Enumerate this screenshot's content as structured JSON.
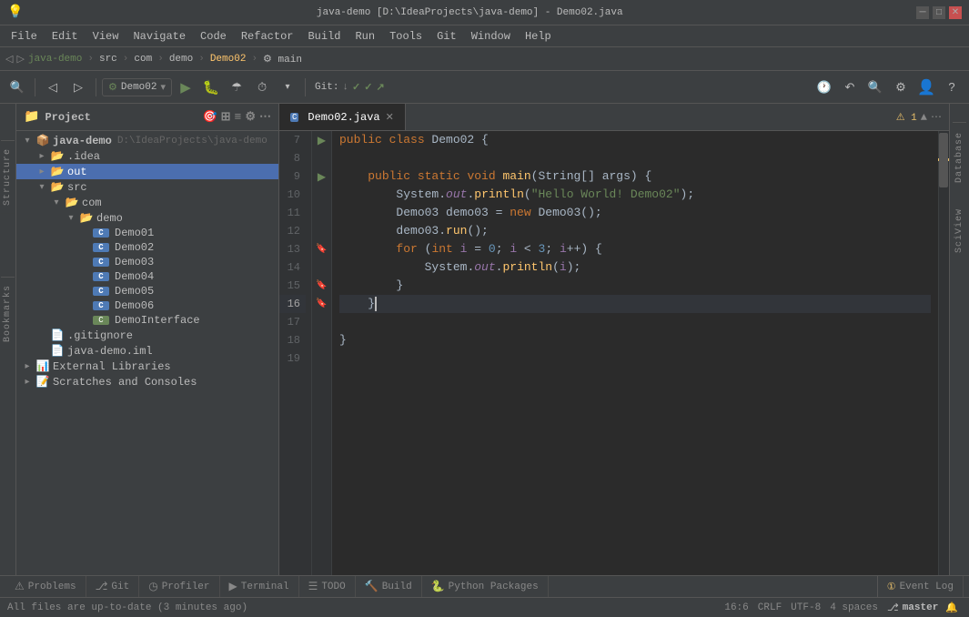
{
  "titleBar": {
    "title": "java-demo [D:\\IdeaProjects\\java-demo] - Demo02.java",
    "appName": "java-demo",
    "minBtn": "─",
    "maxBtn": "□",
    "closeBtn": "✕"
  },
  "menuBar": {
    "items": [
      "File",
      "Edit",
      "View",
      "Navigate",
      "Code",
      "Refactor",
      "Build",
      "Run",
      "Tools",
      "Git",
      "Window",
      "Help"
    ]
  },
  "navBar": {
    "project": "java-demo",
    "parts": [
      "java-demo",
      "src",
      "com",
      "demo",
      "Demo02",
      "main"
    ]
  },
  "toolbar": {
    "runConfig": "Demo02",
    "gitLabel": "Git:",
    "gitBtns": [
      "✓",
      "✓",
      "↗"
    ]
  },
  "projectPanel": {
    "title": "Project",
    "rootName": "java-demo",
    "rootPath": "D:\\IdeaProjects\\java-demo",
    "tree": [
      {
        "indent": 0,
        "type": "root",
        "name": "java-demo",
        "path": "D:\\IdeaProjects\\java-demo",
        "expanded": true
      },
      {
        "indent": 1,
        "type": "folder",
        "name": ".idea",
        "expanded": false
      },
      {
        "indent": 1,
        "type": "folder-out",
        "name": "out",
        "expanded": false,
        "selected": true
      },
      {
        "indent": 1,
        "type": "folder-src",
        "name": "src",
        "expanded": true
      },
      {
        "indent": 2,
        "type": "folder",
        "name": "com",
        "expanded": true
      },
      {
        "indent": 3,
        "type": "folder",
        "name": "demo",
        "expanded": true
      },
      {
        "indent": 4,
        "type": "java",
        "name": "Demo01"
      },
      {
        "indent": 4,
        "type": "java",
        "name": "Demo02"
      },
      {
        "indent": 4,
        "type": "java",
        "name": "Demo03"
      },
      {
        "indent": 4,
        "type": "java",
        "name": "Demo04"
      },
      {
        "indent": 4,
        "type": "java",
        "name": "Demo05"
      },
      {
        "indent": 4,
        "type": "java",
        "name": "Demo06"
      },
      {
        "indent": 4,
        "type": "java-green",
        "name": "DemoInterface"
      },
      {
        "indent": 1,
        "type": "file",
        "name": ".gitignore"
      },
      {
        "indent": 1,
        "type": "iml",
        "name": "java-demo.iml"
      },
      {
        "indent": 0,
        "type": "ext-lib",
        "name": "External Libraries",
        "expanded": false
      },
      {
        "indent": 0,
        "type": "scratch",
        "name": "Scratches and Consoles",
        "expanded": false
      }
    ]
  },
  "editorTab": {
    "fileName": "Demo02.java",
    "modified": false
  },
  "codeLines": [
    {
      "num": 7,
      "content": "public class Demo02 {"
    },
    {
      "num": 8,
      "content": ""
    },
    {
      "num": 9,
      "content": "    public static void main(String[] args) {"
    },
    {
      "num": 10,
      "content": "        System.out.println(\"Hello World! Demo02\");"
    },
    {
      "num": 11,
      "content": "        Demo03 demo03 = new Demo03();"
    },
    {
      "num": 12,
      "content": "        demo03.run();"
    },
    {
      "num": 13,
      "content": "        for (int i = 0; i < 3; i++) {"
    },
    {
      "num": 14,
      "content": "            System.out.println(i);"
    },
    {
      "num": 15,
      "content": "        }"
    },
    {
      "num": 16,
      "content": "    }"
    },
    {
      "num": 17,
      "content": ""
    },
    {
      "num": 18,
      "content": "}"
    },
    {
      "num": 19,
      "content": ""
    }
  ],
  "bottomTabs": [
    {
      "icon": "⚠",
      "label": "Problems"
    },
    {
      "icon": "⎇",
      "label": "Git"
    },
    {
      "icon": "◷",
      "label": "Profiler"
    },
    {
      "icon": "▶",
      "label": "Terminal"
    },
    {
      "icon": "☰",
      "label": "TODO"
    },
    {
      "icon": "🔨",
      "label": "Build"
    },
    {
      "icon": "🐍",
      "label": "Python Packages"
    }
  ],
  "statusBar": {
    "message": "All files are up-to-date (3 minutes ago)",
    "position": "16:6",
    "lineEnding": "CRLF",
    "encoding": "UTF-8",
    "indent": "4 spaces",
    "vcs": "master",
    "warningCount": "1",
    "eventLog": "Event Log"
  },
  "rightPanels": [
    {
      "label": "Database"
    },
    {
      "label": "SciView"
    }
  ],
  "leftPanels": [
    {
      "label": "Structure"
    },
    {
      "label": "Bookmarks"
    }
  ]
}
